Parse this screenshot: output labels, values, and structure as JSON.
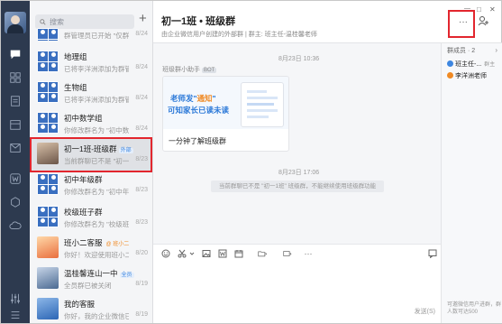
{
  "search": {
    "placeholder": "搜索"
  },
  "list": {
    "items": [
      {
        "name": "",
        "sub": "群管理员已开始 \"仅群...",
        "date": "8/24"
      },
      {
        "name": "地理组",
        "sub": "已将李洋洲添加为群管...",
        "date": "8/24"
      },
      {
        "name": "生物组",
        "sub": "已将李洋洲添加为群管...",
        "date": "8/24"
      },
      {
        "name": "初中数学组",
        "sub": "你修改群名为 \"初中数...",
        "date": "8/24"
      },
      {
        "name": "初一1班-班级群",
        "tag": "外部",
        "sub": "当前群聊已不是 \"初一...",
        "date": "8/23"
      },
      {
        "name": "初中年级群",
        "sub": "你修改群名为 \"初中年...",
        "date": "8/23"
      },
      {
        "name": "校级班子群",
        "sub": "你修改群名为 \"校级班...",
        "date": "8/23"
      },
      {
        "name": "班小二客服",
        "tag": "@ 班小二",
        "sub": "你好！欢迎使用班小二...",
        "date": "8/20"
      },
      {
        "name": "温桂馨连山一中",
        "tag": "全员",
        "sub": "全员群已被关闭",
        "date": "8/19"
      },
      {
        "name": "我的客服",
        "sub": "你好，我的企业微信已...",
        "date": "8/19"
      }
    ]
  },
  "chat": {
    "title": "初一1班 • 班级群",
    "subtitle": "由企业微信用户创建的外部群 | 群主: 班主任-温桂馨老师",
    "time1": "8月23日 10:36",
    "sender": "班级群小助手",
    "sender_tag": "BOT",
    "card_hl_prefix": "老师发\"",
    "card_hl_mid": "通知",
    "card_hl_suffix": "\"",
    "card_hl2": "可知家长已读未读",
    "card_caption": "一分钟了解班级群",
    "time2": "8月23日 17:06",
    "sysmsg": "当前群聊已不是 \"初一1班\" 班级群，不能继续使用班级群功能",
    "more": "···",
    "send": "发送(S)"
  },
  "members": {
    "title": "群成员 · 2",
    "list": [
      {
        "name": "班主任-...",
        "role": "群主"
      },
      {
        "name": "李洋洲老师",
        "role": ""
      }
    ],
    "footer": "可邀微信用户进群，群人数可达500"
  },
  "colors": {
    "nav_bg": "#2d3a4f",
    "accent": "#3d86e0",
    "highlight": "#e2262e"
  }
}
